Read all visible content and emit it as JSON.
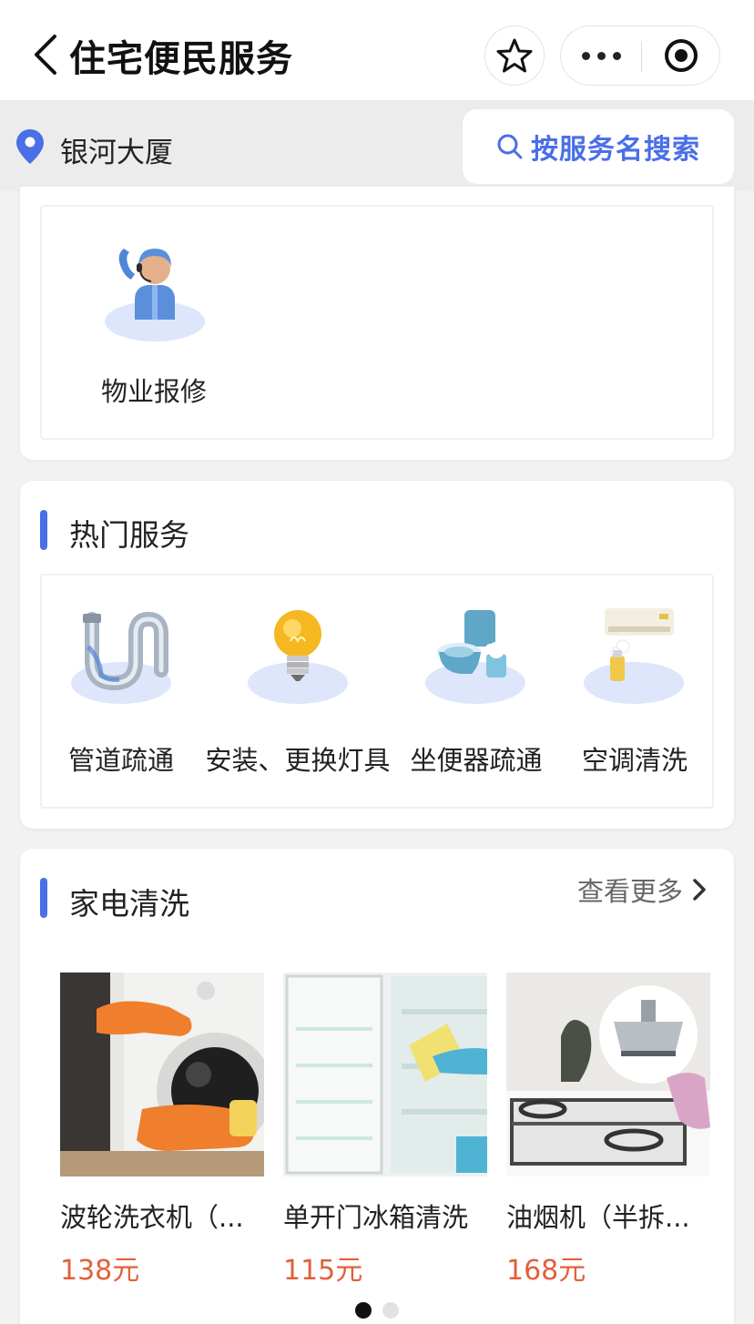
{
  "navbar": {
    "title": "住宅便民服务",
    "back_icon": "chevron-left-icon",
    "favorite_icon": "star-icon",
    "more_icon": "more-dots-icon",
    "close_icon": "record-circle-icon"
  },
  "location": {
    "name": "银河大厦",
    "icon": "location-pin-icon"
  },
  "search": {
    "label": "按服务名搜索",
    "icon": "search-icon"
  },
  "property": {
    "items": [
      {
        "label": "物业报修",
        "icon": "repair-agent-icon"
      }
    ]
  },
  "hot_services": {
    "title": "热门服务",
    "items": [
      {
        "label": "管道疏通",
        "icon": "pipe-icon"
      },
      {
        "label": "安装、更换灯具",
        "icon": "light-bulb-icon"
      },
      {
        "label": "坐便器疏通",
        "icon": "toilet-icon"
      },
      {
        "label": "空调清洗",
        "icon": "air-conditioner-icon"
      }
    ]
  },
  "appliance_cleaning": {
    "title": "家电清洗",
    "more_label": "查看更多",
    "products": [
      {
        "name": "波轮洗衣机（...",
        "price": "138元",
        "image": "washing-machine-photo"
      },
      {
        "name": "单开门冰箱清洗",
        "price": "115元",
        "image": "refrigerator-photo"
      },
      {
        "name": "油烟机（半拆...",
        "price": "168元",
        "image": "range-hood-photo"
      }
    ],
    "pager": {
      "pages": 2,
      "active": 1
    }
  },
  "colors": {
    "accent": "#4a6fe6",
    "price": "#e2603a",
    "ellipse": "#dde6fb"
  }
}
